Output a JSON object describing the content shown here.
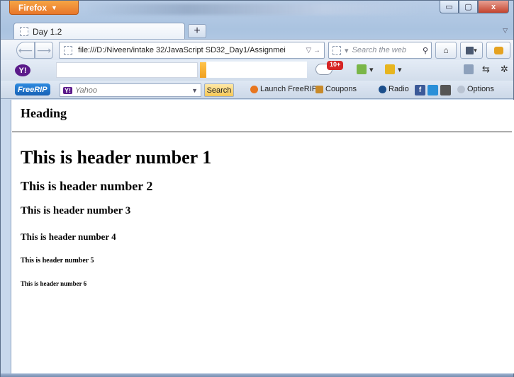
{
  "app": {
    "menu_button": "Firefox",
    "menu_arrow": "▼"
  },
  "window_controls": {
    "minimize": "▭",
    "maximize": "▢",
    "close": "x"
  },
  "tabs": [
    {
      "label": "Day 1.2"
    }
  ],
  "tab_strip": {
    "new_tab": "+",
    "list_tabs": "▽"
  },
  "navigation": {
    "back": "⟵",
    "forward": "⟶",
    "url": "file:///D:/Niveen/intake 32/JavaScript SD32_Day1/Assignmei",
    "url_controls": "▽ →",
    "search_placeholder": "Search the web",
    "search_engine_arrow": "▾",
    "home": "⌂",
    "bookmarks": "▾"
  },
  "yahoo_toolbar": {
    "logo": "Y!",
    "mail_badge": "10+",
    "sep": "▾"
  },
  "freerip_toolbar": {
    "logo": "FreeRIP",
    "yahoo_chip": "Y!",
    "search_placeholder": "Yahoo",
    "search_button": "Search",
    "launch": "Launch FreeRIP",
    "coupons": "Coupons",
    "radio": "Radio",
    "options": "Options"
  },
  "page": {
    "top_heading": "Heading",
    "headers": [
      "This is header number 1",
      "This is header number 2",
      "This is header number 3",
      "This is header number 4",
      "This is header number 5",
      "This is header number 6"
    ]
  },
  "colors": {
    "firefox_orange": "#e8762a",
    "yahoo_purple": "#5b1b8a",
    "freerip_blue": "#1761b5",
    "mail_badge_red": "#d62525"
  }
}
